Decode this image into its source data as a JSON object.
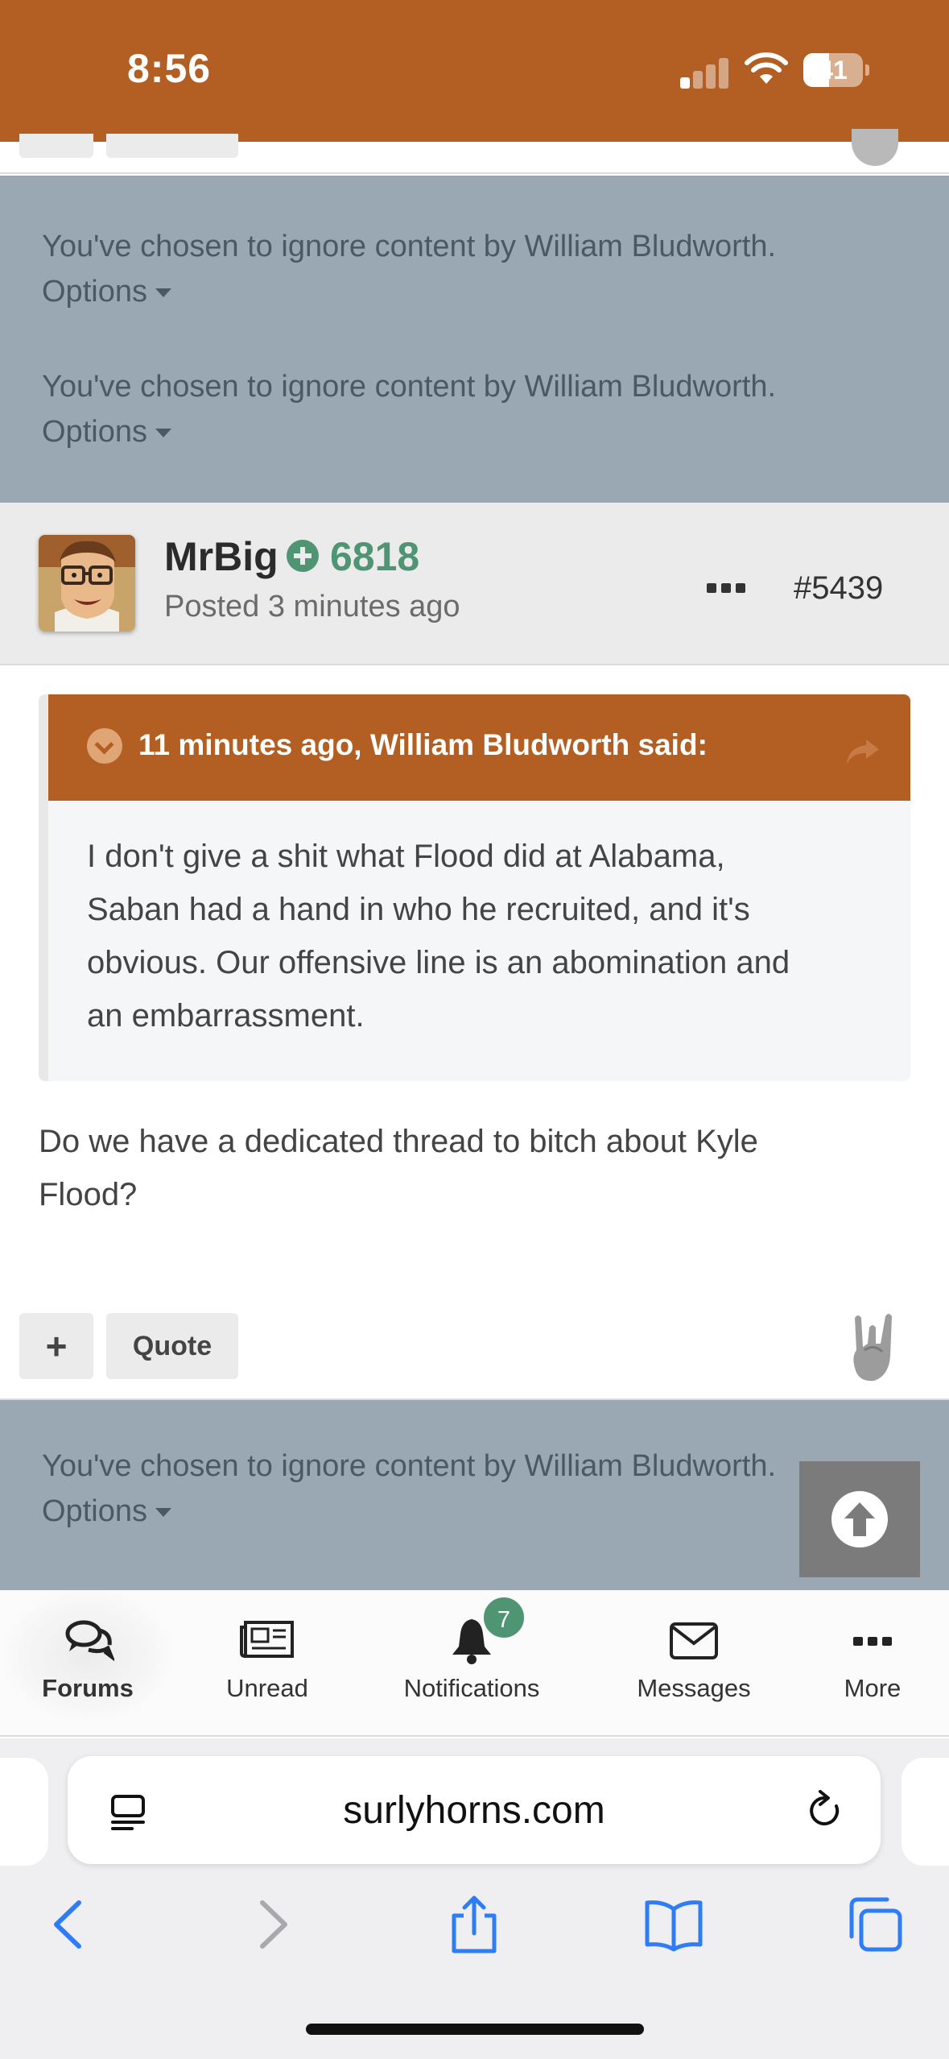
{
  "status_bar": {
    "time": "8:56",
    "battery": "41",
    "signal_bars_on": 1,
    "signal_bars_total": 4
  },
  "ignored_notice": {
    "text": "You've chosen to ignore content by William Bludworth.",
    "options_label": "Options"
  },
  "post": {
    "author": "MrBig",
    "reputation": "6818",
    "posted": "Posted 3 minutes ago",
    "number": "#5439",
    "quote": {
      "header": "11 minutes ago, William Bludworth said:",
      "lines": [
        "I don't give a shit what Flood did at Alabama,",
        "Saban had a hand in who he recruited, and it's",
        "obvious. Our offensive line is an abomination and",
        "an embarrassment."
      ]
    },
    "body_lines": [
      "Do we have a dedicated thread to bitch about Kyle",
      "Flood?"
    ],
    "actions": {
      "plus_label": "+",
      "quote_label": "Quote"
    }
  },
  "bottom_nav": {
    "items": [
      {
        "label": "Forums",
        "icon": "chat-bubbles-icon"
      },
      {
        "label": "Unread",
        "icon": "newspaper-icon"
      },
      {
        "label": "Notifications",
        "icon": "bell-icon"
      },
      {
        "label": "Messages",
        "icon": "envelope-icon"
      },
      {
        "label": "More",
        "icon": "ellipsis-icon"
      }
    ],
    "notifications_badge": "7"
  },
  "browser": {
    "url": "surlyhorns.com"
  },
  "colors": {
    "brand": "#b35e22",
    "ignored_bg": "#9aa8b4",
    "rep_green": "#4f9574"
  }
}
